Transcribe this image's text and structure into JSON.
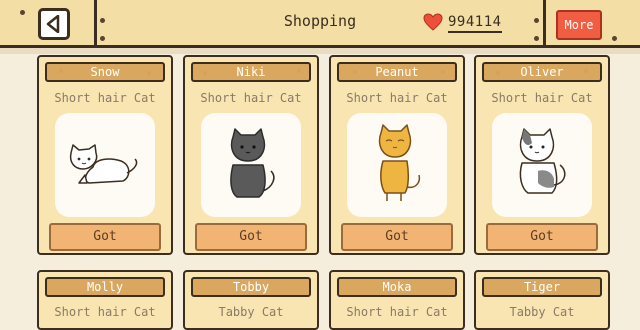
{
  "header": {
    "title": "Shopping",
    "currency_amount": "994114",
    "more_label": "More"
  },
  "colors": {
    "topbar": "#f3dfa6",
    "card": "#f8e5b2",
    "name_plate": "#d9a85e",
    "got_button": "#f1b473",
    "more_button": "#f05d43",
    "heart": "#ef4f3a"
  },
  "cats": [
    {
      "name": "Snow",
      "type": "Short hair Cat",
      "button": "Got",
      "icon": "white-cat-lying-icon"
    },
    {
      "name": "Niki",
      "type": "Short hair Cat",
      "button": "Got",
      "icon": "gray-cat-sitting-icon"
    },
    {
      "name": "Peanut",
      "type": "Short hair Cat",
      "button": "Got",
      "icon": "orange-cat-sitting-icon"
    },
    {
      "name": "Oliver",
      "type": "Short hair Cat",
      "button": "Got",
      "icon": "calico-cat-sitting-icon"
    },
    {
      "name": "Molly",
      "type": "Short hair Cat"
    },
    {
      "name": "Tobby",
      "type": "Tabby Cat"
    },
    {
      "name": "Moka",
      "type": "Short hair Cat"
    },
    {
      "name": "Tiger",
      "type": "Tabby Cat"
    }
  ]
}
